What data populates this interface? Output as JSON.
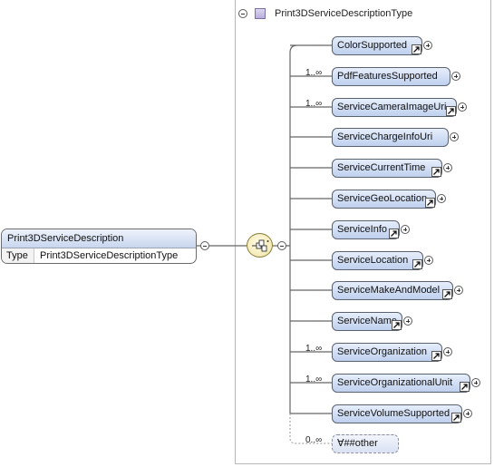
{
  "type_definition": {
    "name": "Print3DServiceDescriptionType"
  },
  "root_element": {
    "name": "Print3DServiceDescription",
    "type_label": "Type",
    "type_value": "Print3DServiceDescriptionType"
  },
  "compositor": {
    "kind": "sequence"
  },
  "children": [
    {
      "name": "ColorSupported",
      "occurs": "",
      "ref": true,
      "optional": false
    },
    {
      "name": "PdfFeaturesSupported",
      "occurs": "1..∞",
      "ref": false,
      "optional": false
    },
    {
      "name": "ServiceCameraImageUri",
      "occurs": "1..∞",
      "ref": true,
      "optional": false
    },
    {
      "name": "ServiceChargeInfoUri",
      "occurs": "",
      "ref": false,
      "optional": false
    },
    {
      "name": "ServiceCurrentTime",
      "occurs": "",
      "ref": true,
      "optional": false
    },
    {
      "name": "ServiceGeoLocation",
      "occurs": "",
      "ref": true,
      "optional": false
    },
    {
      "name": "ServiceInfo",
      "occurs": "",
      "ref": true,
      "optional": false
    },
    {
      "name": "ServiceLocation",
      "occurs": "",
      "ref": true,
      "optional": false
    },
    {
      "name": "ServiceMakeAndModel",
      "occurs": "",
      "ref": true,
      "optional": false
    },
    {
      "name": "ServiceName",
      "occurs": "",
      "ref": true,
      "optional": false
    },
    {
      "name": "ServiceOrganization",
      "occurs": "1..∞",
      "ref": true,
      "optional": false
    },
    {
      "name": "ServiceOrganizationalUnit",
      "occurs": "1..∞",
      "ref": true,
      "optional": false
    },
    {
      "name": "ServiceVolumeSupported",
      "occurs": "",
      "ref": true,
      "optional": false
    }
  ],
  "wildcard": {
    "label": "∀##other",
    "occurs": "0..∞"
  }
}
